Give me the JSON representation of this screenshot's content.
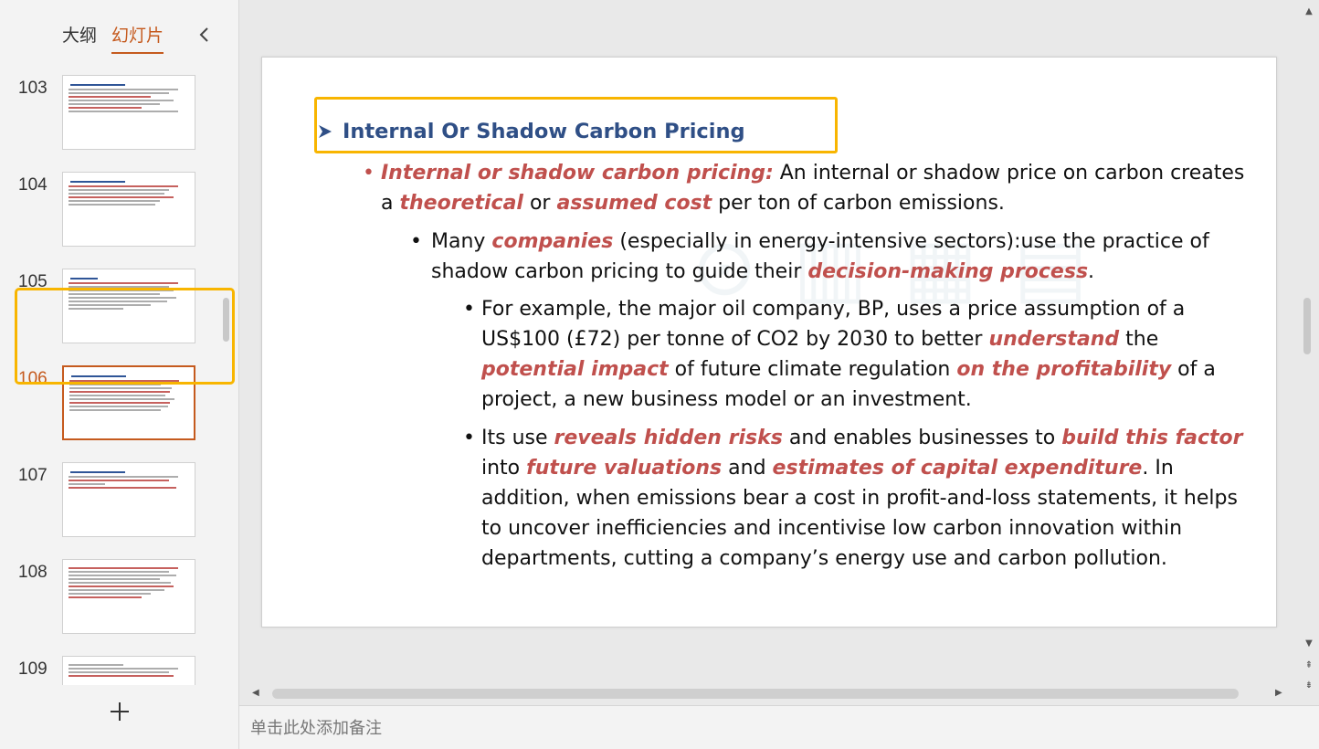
{
  "panel": {
    "tab_outline": "大纲",
    "tab_slides": "幻灯片"
  },
  "thumbnails": [
    {
      "number": "103"
    },
    {
      "number": "104"
    },
    {
      "number": "105"
    },
    {
      "number": "106",
      "selected": true
    },
    {
      "number": "107"
    },
    {
      "number": "108"
    },
    {
      "number": "109"
    }
  ],
  "slide": {
    "title": "Internal Or Shadow Carbon Pricing",
    "bullet1": {
      "h1": "Internal or shadow carbon pricing:",
      "t1": " An internal or shadow price on carbon creates a ",
      "h2": "theoretical",
      "t2": " or ",
      "h3": "assumed cost",
      "t3": " per ton of carbon emissions."
    },
    "bullet2": {
      "t1": "Many ",
      "h1": "companies",
      "t2": " (especially in energy-intensive sectors):use the practice of shadow carbon pricing to guide their ",
      "h2": "decision-making process",
      "t3": "."
    },
    "bullet3": {
      "t1": "For example, the major oil company, BP, uses a price assumption of a US$100 (£72) per tonne of CO2 by 2030 to better ",
      "h1": "understand",
      "t2": " the ",
      "h2": "potential impact",
      "t3": " of future climate regulation ",
      "h3": "on the profitability",
      "t4": " of a project, a new business model or an investment."
    },
    "bullet4": {
      "t1": "Its use ",
      "h1": "reveals hidden risks",
      "t2": " and enables businesses to ",
      "h2": "build this factor",
      "t3": " into ",
      "h3": "future valuations",
      "t4": " and ",
      "h4": "estimates of capital expenditure",
      "t5": ". In addition, when emissions bear a cost in profit-and-loss statements, it helps to uncover inefficiencies and incentivise low carbon innovation within departments, cutting a company’s energy use and carbon pollution."
    }
  },
  "notes": {
    "placeholder": "单击此处添加备注"
  },
  "colors": {
    "accent": "#c55a1e",
    "highlight_box": "#f8b500",
    "title_blue": "#2f4f86",
    "emphasis_red": "#c0504d"
  },
  "icons": {
    "collapse": "chevron-left-icon",
    "add": "plus-icon",
    "title_bullet": "arrow-bullet-icon"
  }
}
